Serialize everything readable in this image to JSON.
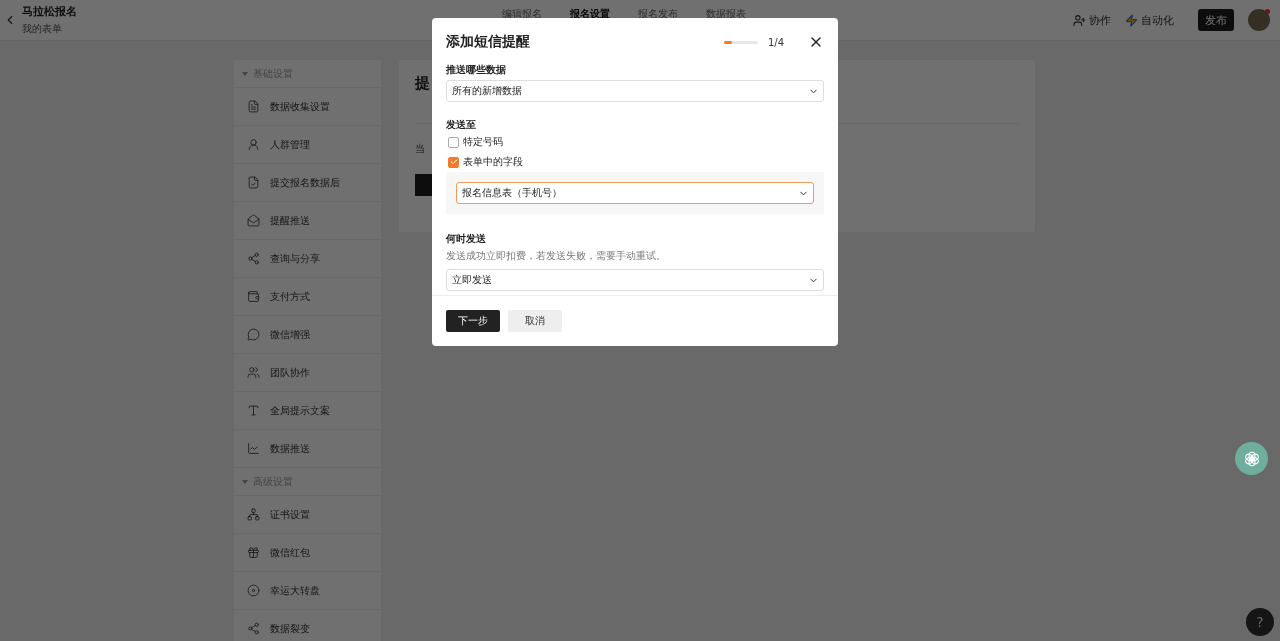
{
  "header": {
    "title": "马拉松报名",
    "subtitle": "我的表单",
    "nav": [
      {
        "label": "编辑报名",
        "selected": false
      },
      {
        "label": "报名设置",
        "selected": true
      },
      {
        "label": "报名发布",
        "selected": false
      },
      {
        "label": "数据报表",
        "selected": false
      }
    ],
    "actions": [
      "协作",
      "自动化"
    ],
    "publish": "发布"
  },
  "sidebar": {
    "groups": [
      {
        "title": "基础设置",
        "items": [
          "数据收集设置",
          "人群管理",
          "提交报名数据后",
          "提醒推送",
          "查询与分享",
          "支付方式",
          "微信增强",
          "团队协作",
          "全局提示文案",
          "数据推送"
        ]
      },
      {
        "title": "高级设置",
        "items": [
          "证书设置",
          "微信红包",
          "幸运大转盘",
          "数据裂变"
        ]
      }
    ]
  },
  "content": {
    "title": "提",
    "text": "当"
  },
  "modal": {
    "title": "添加短信提醒",
    "progress": {
      "level": 0.25,
      "reading": "1/4"
    },
    "data_label": "推送哪些数据",
    "data_value": "所有的新增数据",
    "send_to_label": "发送至",
    "options": [
      {
        "label": "特定号码",
        "checked": false
      },
      {
        "label": "表单中的字段",
        "checked": true
      }
    ],
    "field_value": "报名信息表（手机号）",
    "field_focused": true,
    "when_label": "何时发送",
    "when_hint": "发送成功立即扣费，若发送失败，需要手动重试。",
    "when_value": "立即发送",
    "next": "下一步",
    "cancel": "取消"
  },
  "help": "?"
}
